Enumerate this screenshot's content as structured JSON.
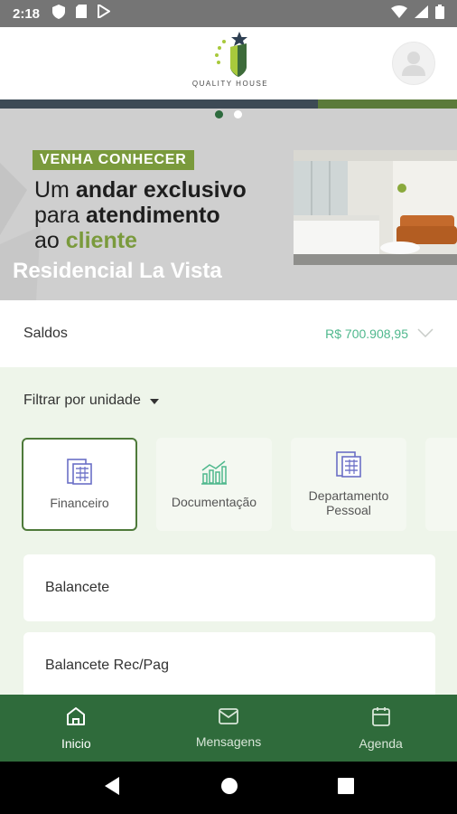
{
  "status_bar": {
    "time": "2:18"
  },
  "header": {
    "logo_text": "QUALITY HOUSE"
  },
  "banner": {
    "tag": "VENHA CONHECER",
    "headline_1_a": "Um ",
    "headline_1_b": "andar exclusivo",
    "headline_2_a": "para ",
    "headline_2_b": "atendimento",
    "headline_3_a": "ao ",
    "headline_3_b": "cliente",
    "subtitle": "Residencial La Vista",
    "active_slide": 1,
    "slide_count": 2
  },
  "saldos": {
    "label": "Saldos",
    "value": "R$ 700.908,95"
  },
  "filter": {
    "label": "Filtrar por unidade"
  },
  "cards": [
    {
      "label": "Financeiro",
      "icon": "spreadsheet-icon"
    },
    {
      "label": "Documentação",
      "icon": "chart-icon"
    },
    {
      "label": "Departamento Pessoal",
      "icon": "spreadsheet-icon"
    }
  ],
  "reports": [
    {
      "label": "Balancete"
    },
    {
      "label": "Balancete Rec/Pag"
    }
  ],
  "bottom_nav": [
    {
      "label": "Inicio",
      "icon": "home-icon"
    },
    {
      "label": "Mensagens",
      "icon": "mail-icon"
    },
    {
      "label": "Agenda",
      "icon": "calendar-icon"
    }
  ],
  "colors": {
    "primary_green": "#2f6b3b",
    "accent_green": "#7a9a3c",
    "balance_green": "#4fb88d",
    "content_bg": "#eef5ea"
  }
}
